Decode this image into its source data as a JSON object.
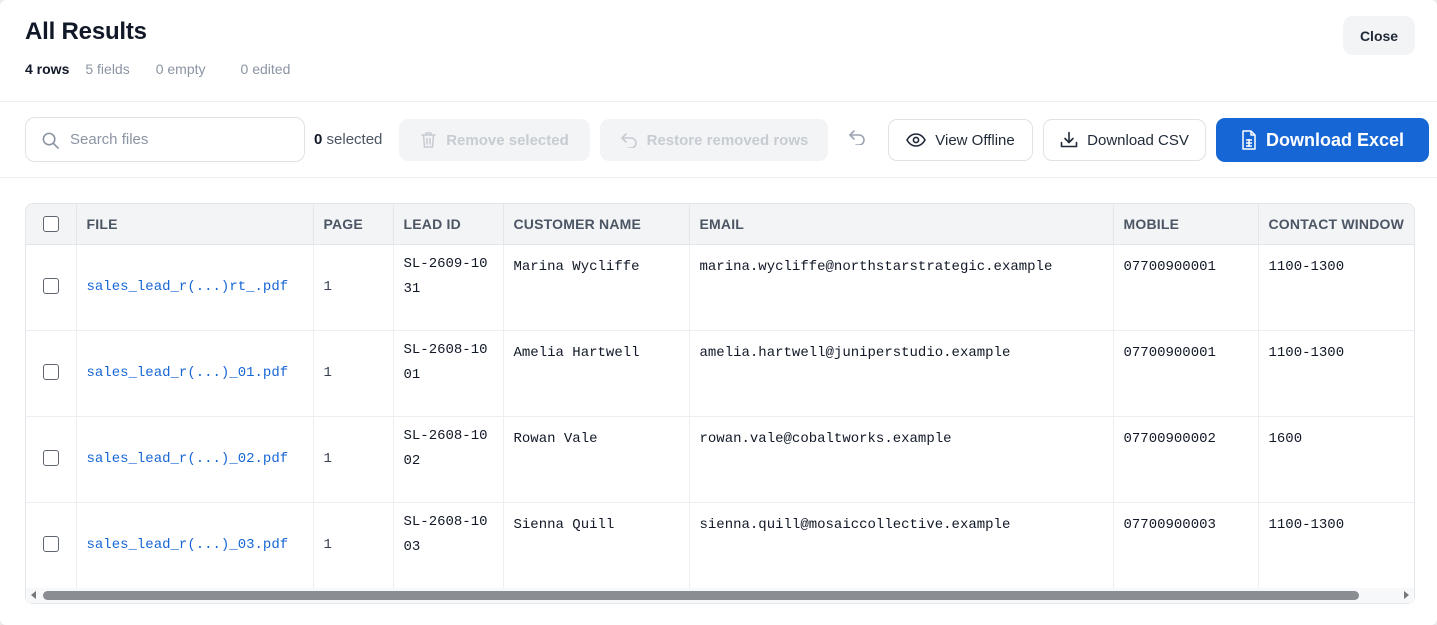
{
  "header": {
    "title": "All Results",
    "stats": {
      "rows": "4 rows",
      "fields": "5 fields",
      "empty": "0 empty",
      "edited": "0 edited"
    },
    "close_label": "Close"
  },
  "toolbar": {
    "search_placeholder": "Search files",
    "selected_count": "0",
    "selected_suffix": "selected",
    "remove_selected_label": "Remove selected",
    "restore_label": "Restore removed rows",
    "view_offline_label": "View Offline",
    "download_csv_label": "Download CSV",
    "download_excel_label": "Download Excel"
  },
  "table": {
    "columns": [
      "FILE",
      "PAGE",
      "LEAD ID",
      "CUSTOMER NAME",
      "EMAIL",
      "MOBILE",
      "CONTACT WINDOW"
    ],
    "rows": [
      {
        "file": "sales_lead_r(...)rt_.pdf",
        "page": "1",
        "lead_id": "SL-2609-1031",
        "customer_name": "Marina Wycliffe",
        "email": "marina.wycliffe@northstarstrategic.example",
        "mobile": "07700900001",
        "contact_window": "1100-1300"
      },
      {
        "file": "sales_lead_r(...)_01.pdf",
        "page": "1",
        "lead_id": "SL-2608-1001",
        "customer_name": "Amelia Hartwell",
        "email": "amelia.hartwell@juniperstudio.example",
        "mobile": "07700900001",
        "contact_window": "1100-1300"
      },
      {
        "file": "sales_lead_r(...)_02.pdf",
        "page": "1",
        "lead_id": "SL-2608-1002",
        "customer_name": "Rowan Vale",
        "email": "rowan.vale@cobaltworks.example",
        "mobile": "07700900002",
        "contact_window": "1600"
      },
      {
        "file": "sales_lead_r(...)_03.pdf",
        "page": "1",
        "lead_id": "SL-2608-1003",
        "customer_name": "Sienna Quill",
        "email": "sienna.quill@mosaiccollective.example",
        "mobile": "07700900003",
        "contact_window": "1100-1300"
      }
    ]
  },
  "colors": {
    "accent": "#1766d6",
    "link": "#1766d6",
    "header_bg": "#f3f4f6",
    "disabled_bg": "#f3f4f6"
  }
}
